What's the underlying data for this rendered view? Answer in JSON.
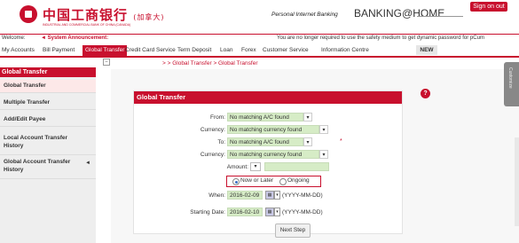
{
  "header": {
    "bank_cn": "中国工商银行",
    "bank_cn_sub": "(加拿大)",
    "bank_en": "INDUSTRIAL AND COMMERCIAL BANK OF CHINA (CANADA)",
    "pib": "Personal Internet Banking",
    "banking_home": "BANKING@HOME",
    "sign_off": "Sign on out"
  },
  "welcome_bar": {
    "welcome": "Welcome:",
    "system_announcement": "◄ System Announcement:",
    "notice": "You are no longer required to use the safety medium to get dynamic password for pCum"
  },
  "nav": {
    "items": [
      "My Accounts",
      "Bill Payment",
      "Global Transfer",
      "Credit Card Service",
      "Term Deposit",
      "Loan",
      "Forex",
      "Customer Service",
      "Information Centre"
    ],
    "active": "Global Transfer",
    "new_label": "NEW"
  },
  "sidebar": {
    "title": "Global Transfer",
    "items": [
      "Global Transfer",
      "Multiple Transfer",
      "Add/Edit Payee",
      "Local Account Transfer History",
      "Global Account Transfer History"
    ]
  },
  "breadcrumb": "> > Global Transfer > Global Transfer",
  "scroll_tab": "Customize",
  "panel": {
    "title": "Global Transfer",
    "help": "?",
    "from_label": "From:",
    "from_value": "No matching A/C found",
    "currency1_label": "Currency:",
    "currency1_value": "No matching currency found",
    "to_label": "To:",
    "to_value": "No matching A/C found",
    "currency2_label": "Currency:",
    "currency2_value": "No matching currency found",
    "amount_label": "Amount:",
    "required_mark": "*",
    "radio_now": "Now or Later",
    "radio_ongoing": "Ongoing",
    "when_label": "When:",
    "when_value": "2016-02-09",
    "when_format": "(YYYY-MM-DD)",
    "start_label": "Starting Date:",
    "start_value": "2016-02-10",
    "start_format": "(YYYY-MM-DD)",
    "next_step": "Next Step"
  },
  "colors": {
    "accent": "#c8102e",
    "field_green": "#d6ecc6"
  }
}
